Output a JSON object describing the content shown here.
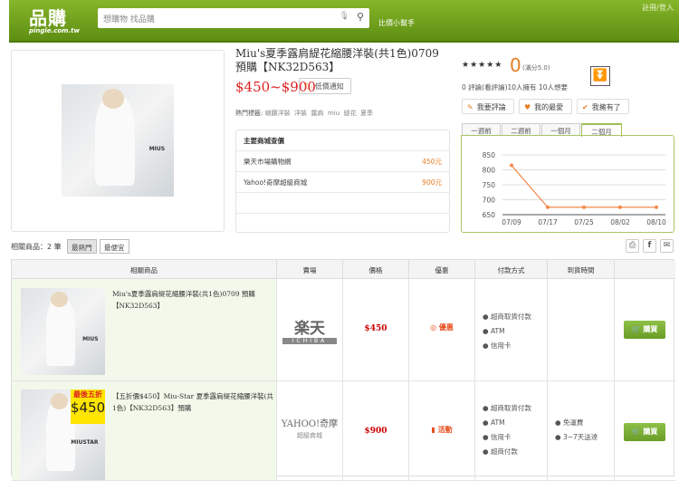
{
  "header": {
    "logo": "品購",
    "logo_sub": "pingle.com.tw",
    "search_placeholder": "想購物 找品購",
    "helper": "比價小幫手",
    "login": "註冊/登入"
  },
  "product": {
    "title": "Miu's夏季露肩緹花縮腰洋裝(共1色)0709 預購【NK32D563】",
    "price": "$450~$900",
    "notify": "低價通知",
    "tags_label": "熱門標籤:",
    "tags": [
      "縮腰洋裝",
      "洋裝",
      "露肩",
      "miu",
      "緹花",
      "夏季"
    ],
    "image_label": "MIUS"
  },
  "shops": {
    "title": "主要商城查價",
    "rows": [
      {
        "name": "樂天市場購物網",
        "price": "450元"
      },
      {
        "name": "Yahoo!奇摩超級商城",
        "price": "900元"
      }
    ]
  },
  "rating": {
    "stars": "★★★★★",
    "score": "0",
    "out_of": "(滿分5.0)",
    "summary": "0 評論(看評論)10人擁有 10人想要"
  },
  "actions": {
    "review": "我要評論",
    "fav": "我的最愛",
    "own": "我擁有了"
  },
  "tabs": [
    "一週前",
    "二週前",
    "一個月",
    "二個月"
  ],
  "active_tab": 3,
  "chart_data": {
    "type": "line",
    "categories": [
      "07/09",
      "07/17",
      "07/25",
      "08/02",
      "08/10"
    ],
    "values": [
      815,
      675,
      675,
      675,
      675
    ],
    "ylim": [
      650,
      850
    ],
    "yticks": [
      650,
      700,
      750,
      800,
      850
    ],
    "color": "#f08a4b",
    "grid": true
  },
  "related": {
    "label": "相關商品：2 筆",
    "sort": [
      "最熱門",
      "最便宜"
    ]
  },
  "table": {
    "headers": [
      "相關商品",
      "賣場",
      "價格",
      "優惠",
      "付款方式",
      "到貨時間",
      ""
    ],
    "rows": [
      {
        "name": "Miu's夏季露肩緹花縮腰洋裝(共1色)0709 預購【NK32D563】",
        "store": "楽天",
        "store_sub": "ICHIBA",
        "price": "$450",
        "promo": "優惠",
        "pay": [
          "超商取貨付款",
          "ATM",
          "信用卡"
        ],
        "ship": [],
        "buy": "購買",
        "img_label": "MIUS"
      },
      {
        "name": "【五折價$450】Miu-Star 夏季露肩緹花縮腰洋裝(共1色)【NK32D563】預購",
        "store": "YAHOO!奇摩",
        "store_sub": "超級商城",
        "price": "$900",
        "promo": "活動",
        "pay": [
          "超商取貨付款",
          "ATM",
          "信用卡",
          "超商付款"
        ],
        "ship": [
          "免運費",
          "3~7天送達"
        ],
        "buy": "購買",
        "img_label": "MIUSTAR",
        "badge_top": "最後五折",
        "badge_price": "$450"
      }
    ]
  }
}
